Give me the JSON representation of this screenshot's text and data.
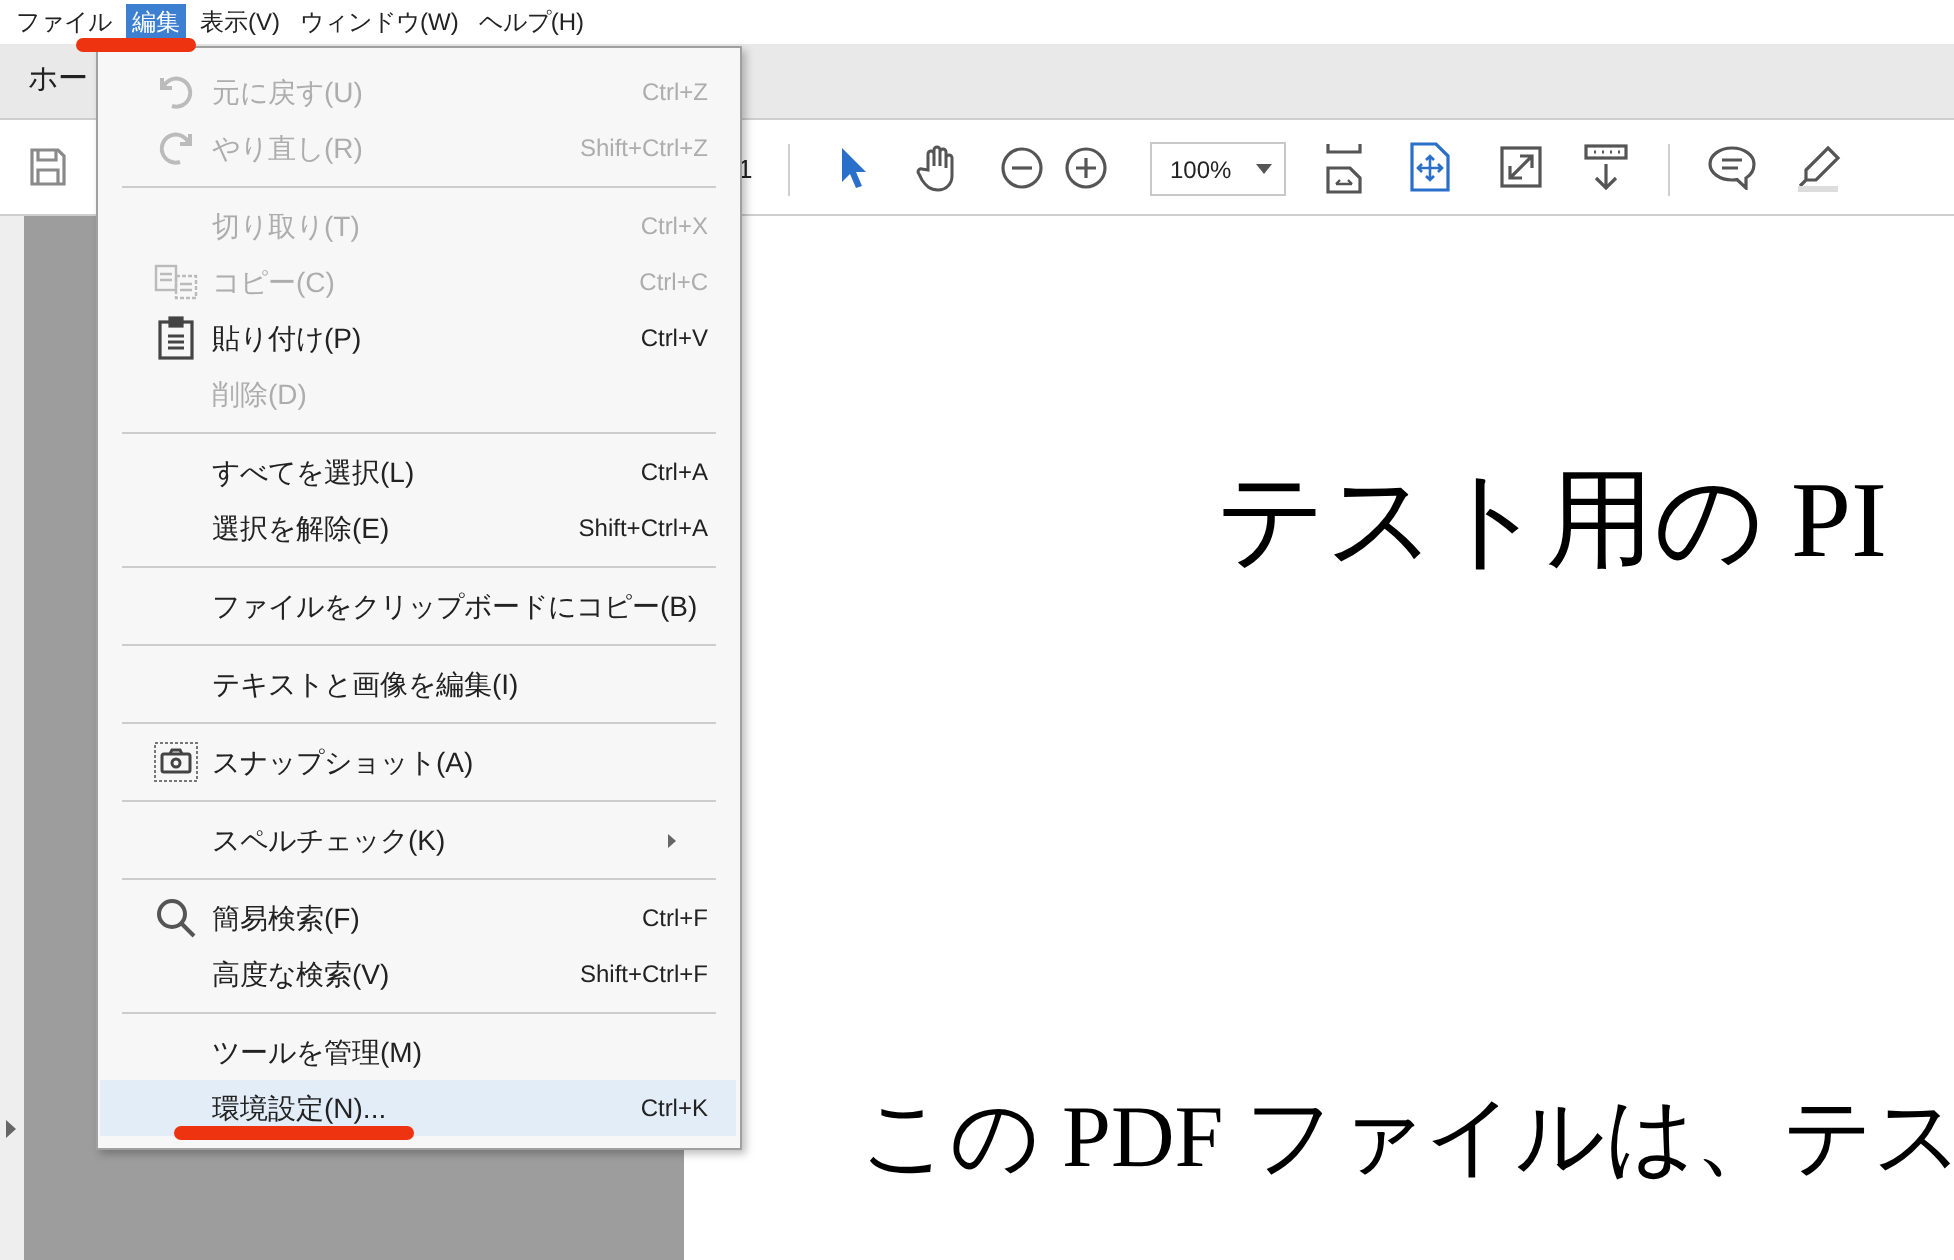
{
  "menu_bar": [
    {
      "label": "ファイル",
      "selected": false
    },
    {
      "label": "編集",
      "selected": true
    },
    {
      "label": "表示(V)",
      "selected": false
    },
    {
      "label": "ウィンドウ(W)",
      "selected": false
    },
    {
      "label": "ヘルプ(H)",
      "selected": false
    }
  ],
  "tab_bar": {
    "tab_label": "ホー"
  },
  "toolbar": {
    "page_number": "1",
    "zoom": "100%"
  },
  "edit_menu": [
    {
      "kind": "item",
      "label": "元に戻す(U)",
      "shortcut": "Ctrl+Z",
      "disabled": true,
      "selected": false
    },
    {
      "kind": "item",
      "label": "やり直し(R)",
      "shortcut": "Shift+Ctrl+Z",
      "disabled": true,
      "selected": false
    },
    {
      "kind": "separator"
    },
    {
      "kind": "item",
      "label": "切り取り(T)",
      "shortcut": "Ctrl+X",
      "disabled": true,
      "selected": false
    },
    {
      "kind": "item",
      "label": "コピー(C)",
      "shortcut": "Ctrl+C",
      "disabled": true,
      "selected": false
    },
    {
      "kind": "item",
      "label": "貼り付け(P)",
      "shortcut": "Ctrl+V",
      "disabled": false,
      "selected": false
    },
    {
      "kind": "item",
      "label": "削除(D)",
      "disabled": true,
      "selected": false
    },
    {
      "kind": "separator"
    },
    {
      "kind": "item",
      "label": "すべてを選択(L)",
      "shortcut": "Ctrl+A",
      "disabled": false,
      "selected": false
    },
    {
      "kind": "item",
      "label": "選択を解除(E)",
      "shortcut": "Shift+Ctrl+A",
      "disabled": false,
      "selected": false
    },
    {
      "kind": "separator"
    },
    {
      "kind": "item",
      "label": "ファイルをクリップボードにコピー(B)",
      "disabled": false,
      "selected": false
    },
    {
      "kind": "separator"
    },
    {
      "kind": "item",
      "label": "テキストと画像を編集(I)",
      "disabled": false,
      "selected": false
    },
    {
      "kind": "separator"
    },
    {
      "kind": "item",
      "label": "スナップショット(A)",
      "disabled": false,
      "selected": false
    },
    {
      "kind": "separator"
    },
    {
      "kind": "submenu",
      "label": "スペルチェック(K)",
      "disabled": false,
      "selected": false
    },
    {
      "kind": "separator"
    },
    {
      "kind": "item",
      "label": "簡易検索(F)",
      "shortcut": "Ctrl+F",
      "disabled": false,
      "selected": false
    },
    {
      "kind": "item",
      "label": "高度な検索(V)",
      "shortcut": "Shift+Ctrl+F",
      "disabled": false,
      "selected": false
    },
    {
      "kind": "separator"
    },
    {
      "kind": "item",
      "label": "ツールを管理(M)",
      "disabled": false,
      "selected": false
    },
    {
      "kind": "item",
      "label": "環境設定(N)...",
      "shortcut": "Ctrl+K",
      "disabled": false,
      "selected": true
    }
  ],
  "document": {
    "title": "テスト用の PI",
    "body_lines": [
      "この PDF ファイルは、テス"
    ]
  }
}
